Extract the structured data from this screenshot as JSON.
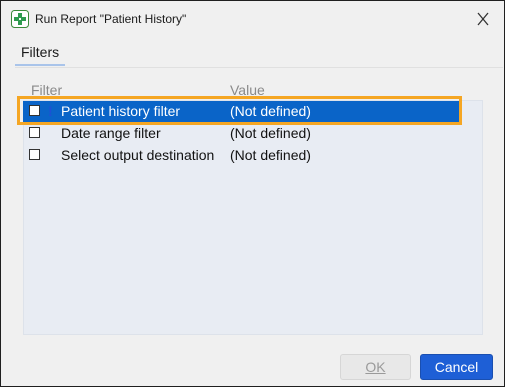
{
  "window": {
    "title": "Run Report \"Patient History\""
  },
  "tabs": [
    {
      "label": "Filters"
    }
  ],
  "grid": {
    "columns": [
      "Filter",
      "Value"
    ],
    "rows": [
      {
        "filter": "Patient history filter",
        "value": "(Not defined)",
        "checked": false,
        "required": true,
        "selected": true
      },
      {
        "filter": "Date range filter",
        "value": "(Not defined)",
        "checked": false,
        "required": false,
        "selected": false
      },
      {
        "filter": "Select output destination",
        "value": "(Not defined)",
        "checked": false,
        "required": false,
        "selected": false
      }
    ],
    "required_mark": "!"
  },
  "buttons": {
    "ok_label": "OK",
    "cancel_label": "Cancel"
  },
  "colors": {
    "selection": "#0a64c8",
    "highlight_outline": "#f5a623",
    "primary_button": "#1e5fd6"
  }
}
